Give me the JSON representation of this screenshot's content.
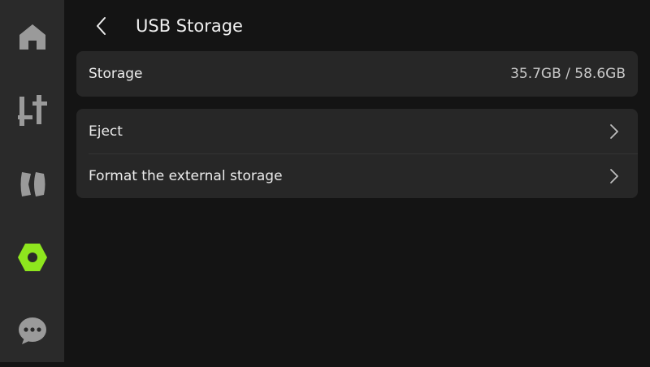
{
  "colors": {
    "background": "#141414",
    "sidebar": "#2a2a2a",
    "card": "#272727",
    "icon_inactive": "#9a9a9a",
    "accent": "#8ee61e",
    "text_primary": "#ececec",
    "text_secondary": "#c8c8c8"
  },
  "sidebar": {
    "items": [
      {
        "icon": "home-icon",
        "active": false
      },
      {
        "icon": "sliders-icon",
        "active": false
      },
      {
        "icon": "filament-icon",
        "active": false
      },
      {
        "icon": "settings-icon",
        "active": true
      },
      {
        "icon": "chat-icon",
        "active": false
      }
    ]
  },
  "header": {
    "back_icon": "chevron-left-icon",
    "title": "USB Storage"
  },
  "storage": {
    "label": "Storage",
    "value": "35.7GB / 58.6GB"
  },
  "actions": [
    {
      "label": "Eject",
      "icon": "chevron-right-icon"
    },
    {
      "label": "Format the external storage",
      "icon": "chevron-right-icon"
    }
  ]
}
